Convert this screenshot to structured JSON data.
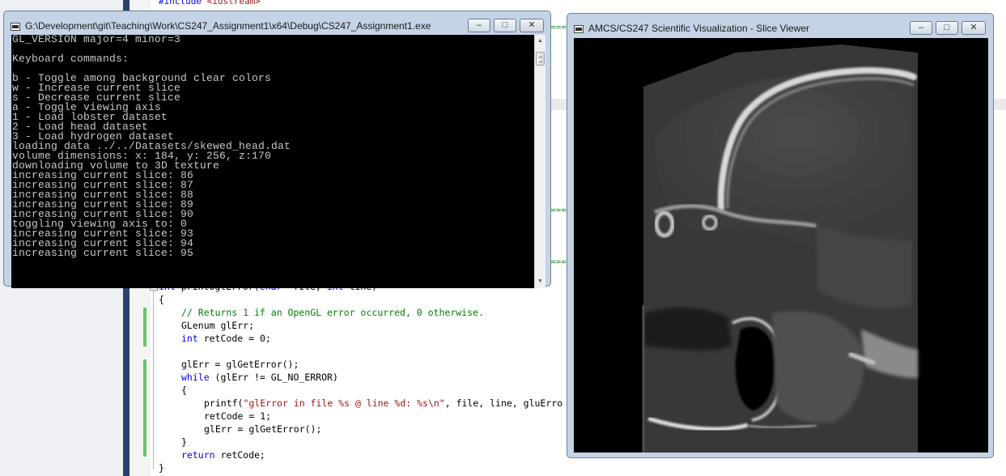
{
  "editor": {
    "include_line": {
      "keyword": "#include",
      "header": "<iostream>"
    },
    "dashes": "===",
    "code": {
      "signature": {
        "ret": "int",
        "name": " printOglError(",
        "p1type": "char",
        "p1": " *file, ",
        "p2type": "int",
        "p2": " line)"
      },
      "open_brace": "{",
      "comment": "// Returns 1 if an OpenGL error occurred, 0 otherwise.",
      "decl1": "GLenum glErr;",
      "decl2_kw": "int",
      "decl2": " retCode = 0;",
      "assign1": "glErr = glGetError();",
      "while_kw": "while",
      "while_cond": " (glErr != GL_NO_ERROR)",
      "inner_open": "{",
      "printf_fn": "printf(",
      "printf_str": "\"glError in file %s @ line %d: %s\\n\"",
      "printf_args": ", file, line, gluErro",
      "retcode_set": "retCode = 1;",
      "assign2": "glErr = glGetError();",
      "inner_close": "}",
      "return_kw": "return",
      "return_val": " retCode;",
      "close_brace": "}"
    }
  },
  "console_window": {
    "title": "G:\\Development\\git\\Teaching\\Work\\CS247_Assignment1\\x64\\Debug\\CS247_Assignment1.exe",
    "lines": [
      "GL_VERSION major=4 minor=3",
      "",
      "Keyboard commands:",
      "",
      "b - Toggle among background clear colors",
      "w - Increase current slice",
      "s - Decrease current slice",
      "a - Toggle viewing axis",
      "1 - Load lobster dataset",
      "2 - Load head dataset",
      "3 - Load hydrogen dataset",
      "loading data ../../Datasets/skewed_head.dat",
      "volume dimensions: x: 184, y: 256, z:170",
      "downloading volume to 3D texture",
      "increasing current slice: 86",
      "increasing current slice: 87",
      "increasing current slice: 88",
      "increasing current slice: 89",
      "increasing current slice: 90",
      "toggling viewing axis to: 0",
      "increasing current slice: 93",
      "increasing current slice: 94",
      "increasing current slice: 95"
    ]
  },
  "viewer_window": {
    "title": "AMCS/CS247 Scientific Visualization - Slice Viewer"
  },
  "window_controls": {
    "minimize": "–",
    "maximize": "□",
    "close": "✕"
  },
  "scrollbar": {
    "up": "▲",
    "down": "▼"
  },
  "colors": {
    "console_bg": "#000000",
    "console_text": "#c8c8c8",
    "window_frame": "#c4d3e6",
    "code_keyword": "#0000ff",
    "code_comment": "#008000",
    "code_string": "#a31515"
  }
}
